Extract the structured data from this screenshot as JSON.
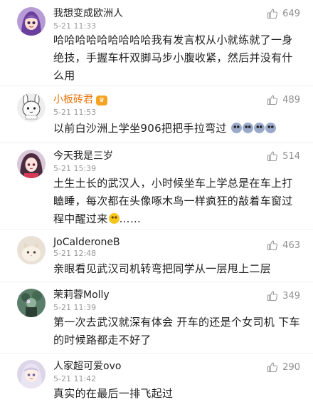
{
  "comments": [
    {
      "username": "我想变成欧洲人",
      "time": "5-21 11:33",
      "likes": "649",
      "text": "哈哈哈哈哈哈哈哈哈我有发言权从小就练就了一身绝技，手握车杆双脚马步小腹收紧，然后并没有什么用"
    },
    {
      "username": "小板砖君",
      "time": "5-21 11:53",
      "likes": "489",
      "text": "以前白沙洲上学坐906把把手拉弯过"
    },
    {
      "username": "今天我是三岁",
      "time": "5-21 15:39",
      "likes": "514",
      "text": "土生土长的武汉人，小时候坐车上学总是在车上打瞌睡，每次都在头像啄木鸟一样疯狂的敲着车窗过程中醒过来",
      "text_suffix": "……"
    },
    {
      "username": "JoCalderoneB",
      "time": "5-21 12:48",
      "likes": "463",
      "text": "亲眼看见武汉司机转弯把同学从一层甩上二层"
    },
    {
      "username": "茉莉蓉Molly",
      "time": "5-21 11:39",
      "likes": "349",
      "text": "第一次去武汉就深有体会 开车的还是个女司机 下车的时候路都走不好了"
    },
    {
      "username": "人家超可爱ovo",
      "time": "5-21 11:42",
      "likes": "290",
      "text": "真实的在最后一排飞起过"
    }
  ],
  "colors": {
    "vip_name": "#e8730b",
    "time": "#9a9a9a",
    "like_count": "#8f8f8f",
    "separator": "#efefef"
  },
  "icons": {
    "like": "thumbs-up-icon",
    "vip_badge": "vip-badge-icon",
    "emoji_cry": "crying-face-emoji",
    "emoji_think": "thinking-face-emoji"
  }
}
